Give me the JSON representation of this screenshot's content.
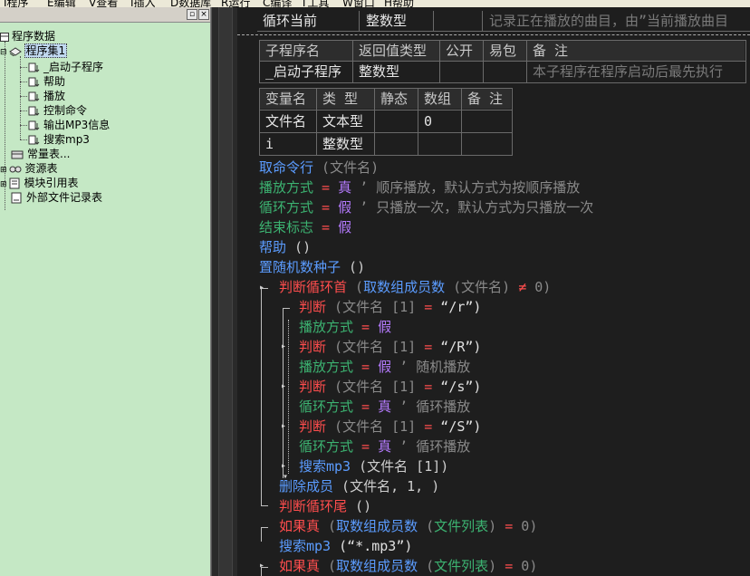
{
  "menu": [
    "I程序",
    "E编辑",
    "V查看",
    "I插入",
    "D数据库",
    "R运行",
    "C编译",
    "T工具",
    "W窗口",
    "H帮助"
  ],
  "tree": {
    "root": "程序数据",
    "assembly": "程序集1",
    "subs": [
      "_启动子程序",
      "帮助",
      "播放",
      "控制命令",
      "输出MP3信息",
      "搜索mp3"
    ],
    "others": [
      "常量表...",
      "资源表",
      "模块引用表",
      "外部文件记录表"
    ]
  },
  "top_row": {
    "name": "循环当前",
    "type": "整数型",
    "note": "记录正在播放的曲目，由”当前播放曲目"
  },
  "sub_table": {
    "headers": [
      "子程序名",
      "返回值类型",
      "公开",
      "易包",
      "备 注"
    ],
    "row": [
      "_启动子程序",
      "整数型",
      "",
      "",
      "本子程序在程序启动后最先执行"
    ]
  },
  "var_table": {
    "headers": [
      "变量名",
      "类 型",
      "静态",
      "数组",
      "备 注"
    ],
    "rows": [
      [
        "文件名",
        "文本型",
        "",
        "0",
        ""
      ],
      [
        "i",
        "整数型",
        "",
        "",
        ""
      ]
    ]
  },
  "code": {
    "l1": {
      "fn": "取命令行",
      "args": " (文件名)"
    },
    "l2": {
      "v": "播放方式",
      "op": " = ",
      "val": "真",
      "cmt": "  ’ 顺序播放，默认方式为按顺序播放"
    },
    "l3": {
      "v": "循环方式",
      "op": " = ",
      "val": "假",
      "cmt": "  ’ 只播放一次，默认方式为只播放一次"
    },
    "l4": {
      "v": "结束标志",
      "op": " = ",
      "val": "假"
    },
    "l5": {
      "fn": "帮助",
      "args": " ()"
    },
    "l6": {
      "fn": "置随机数种子",
      "args": " ()"
    },
    "l7": {
      "kw": "判断循环首",
      "p1": " (",
      "fn": "取数组成员数",
      "args": " (文件名)",
      "ne": " ≠ ",
      "n": "0)"
    },
    "l8": {
      "kw": "判断",
      "args": " (文件名 [1] ",
      "eq": "=",
      "s": " “/r”)"
    },
    "l9": {
      "v": "播放方式",
      "op": " = ",
      "val": "假"
    },
    "l10": {
      "kw": "判断",
      "args": " (文件名 [1] ",
      "eq": "=",
      "s": " “/R”)"
    },
    "l11": {
      "v": "播放方式",
      "op": " = ",
      "val": "假",
      "cmt": "  ’ 随机播放"
    },
    "l12": {
      "kw": "判断",
      "args": " (文件名 [1] ",
      "eq": "=",
      "s": " “/s”)"
    },
    "l13": {
      "v": "循环方式",
      "op": " = ",
      "val": "真",
      "cmt": "  ’ 循环播放"
    },
    "l14": {
      "kw": "判断",
      "args": " (文件名 [1] ",
      "eq": "=",
      "s": " “/S”)"
    },
    "l15": {
      "v": "循环方式",
      "op": " = ",
      "val": "真",
      "cmt": "  ’ 循环播放"
    },
    "l16": {
      "fn": "搜索mp3",
      "args": " (文件名 [1])"
    },
    "l17": {
      "fn": "删除成员",
      "args": " (文件名, 1, )"
    },
    "l18": {
      "kw": "判断循环尾",
      "args": " ()"
    },
    "l19": {
      "kw": "如果真",
      "p1": " (",
      "fn": "取数组成员数",
      "p2": " (",
      "v": "文件列表",
      "rest": ") ",
      "eq": "=",
      "n": " 0)"
    },
    "l20": {
      "fn": "搜索mp3",
      "args": " (“*.mp3”)"
    },
    "l21": {
      "kw": "如果真",
      "p1": " (",
      "fn": "取数组成员数",
      "p2": " (",
      "v": "文件列表",
      "rest": ") ",
      "eq": "=",
      "n": " 0)"
    }
  }
}
